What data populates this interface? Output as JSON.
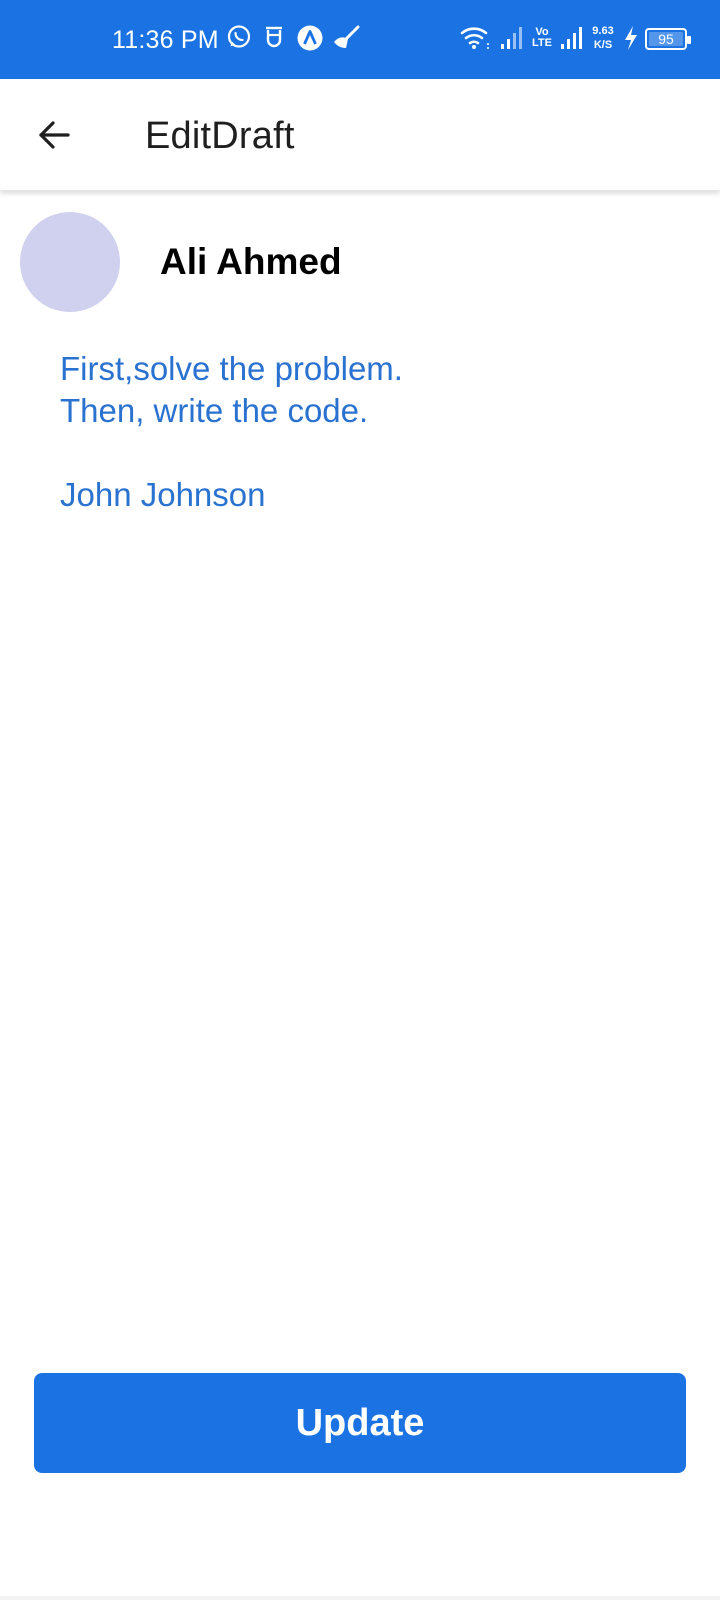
{
  "status_bar": {
    "time": "11:36 PM",
    "network_1": "Vo\nLTE",
    "speed_value": "9.63",
    "speed_unit": "K/S",
    "battery": "95",
    "icons": [
      "whatsapp-icon",
      "notification-icon",
      "app-icon",
      "cleaner-icon",
      "wifi-icon",
      "signal-icon",
      "volte-icon",
      "signal-icon",
      "charging-icon",
      "battery-icon"
    ]
  },
  "app_bar": {
    "title": "EditDraft",
    "back_icon": "arrow-left-icon"
  },
  "sender": {
    "name": "Ali Ahmed"
  },
  "draft": {
    "lines": [
      "First,solve the problem.",
      "Then, write the code.",
      "",
      "John Johnson"
    ]
  },
  "actions": {
    "update_label": "Update"
  },
  "colors": {
    "primary": "#1b73e3",
    "body_text": "#2a72d0",
    "avatar": "#cfd1ee"
  }
}
